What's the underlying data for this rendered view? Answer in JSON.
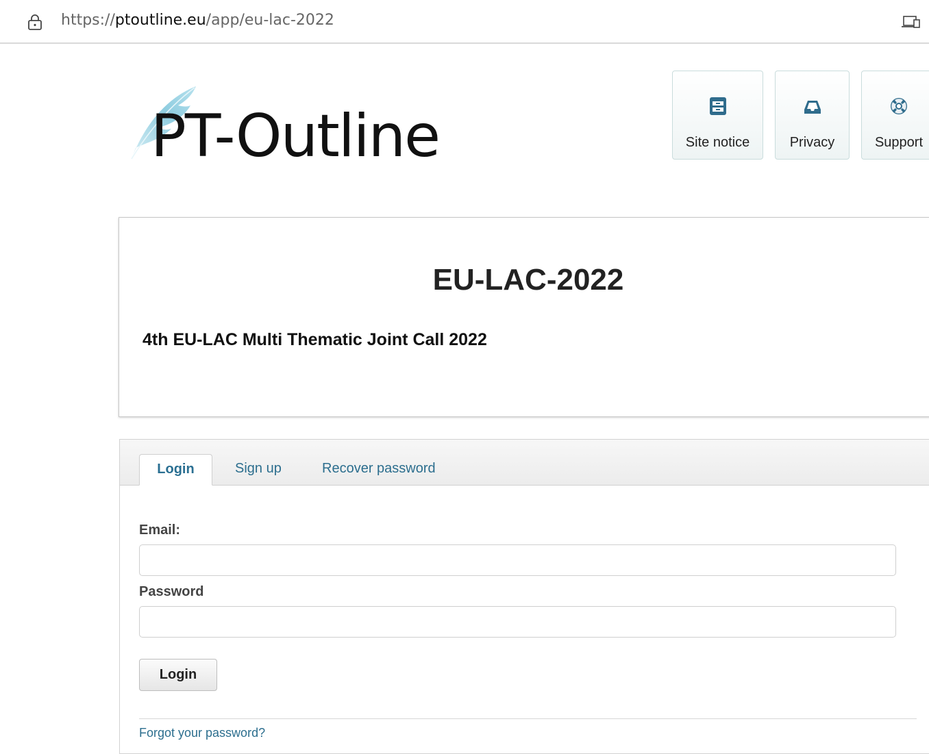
{
  "browser": {
    "url_prefix": "https://",
    "url_host": "ptoutline.eu",
    "url_path": "/app/eu-lac-2022",
    "icons": {
      "lock": "lock-icon",
      "device": "device-icon"
    }
  },
  "header": {
    "logo_text": "PT-Outline",
    "nav": [
      {
        "label": "Site notice",
        "icon": "cabinet-icon"
      },
      {
        "label": "Privacy",
        "icon": "inbox-icon"
      },
      {
        "label": "Support",
        "icon": "lifebuoy-icon"
      }
    ]
  },
  "call": {
    "title": "EU-LAC-2022",
    "subtitle": "4th EU-LAC Multi Thematic Joint Call 2022"
  },
  "login_panel": {
    "tabs": [
      {
        "label": "Login",
        "active": true
      },
      {
        "label": "Sign up",
        "active": false
      },
      {
        "label": "Recover password",
        "active": false
      }
    ],
    "email_label": "Email:",
    "email_value": "",
    "password_label": "Password",
    "password_value": "",
    "submit_label": "Login",
    "forgot_link": "Forgot your password?"
  },
  "colors": {
    "link": "#2c6e8e",
    "nav_icon": "#2f6c8c",
    "nav_border": "#c9dcdc",
    "feather": "#9fd3e3"
  }
}
